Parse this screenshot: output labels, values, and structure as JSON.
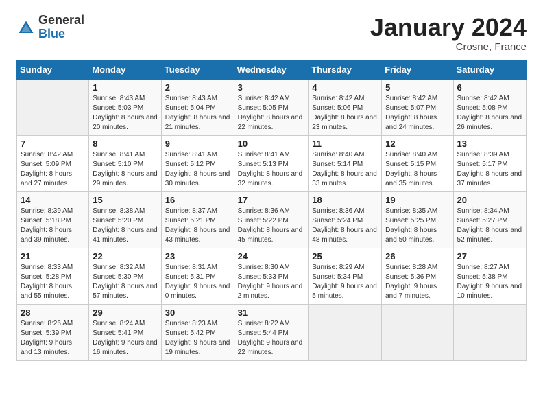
{
  "logo": {
    "general": "General",
    "blue": "Blue"
  },
  "header": {
    "title": "January 2024",
    "subtitle": "Crosne, France"
  },
  "weekdays": [
    "Sunday",
    "Monday",
    "Tuesday",
    "Wednesday",
    "Thursday",
    "Friday",
    "Saturday"
  ],
  "weeks": [
    [
      {
        "day": "",
        "empty": true
      },
      {
        "day": "1",
        "sunrise": "Sunrise: 8:43 AM",
        "sunset": "Sunset: 5:03 PM",
        "daylight": "Daylight: 8 hours and 20 minutes."
      },
      {
        "day": "2",
        "sunrise": "Sunrise: 8:43 AM",
        "sunset": "Sunset: 5:04 PM",
        "daylight": "Daylight: 8 hours and 21 minutes."
      },
      {
        "day": "3",
        "sunrise": "Sunrise: 8:42 AM",
        "sunset": "Sunset: 5:05 PM",
        "daylight": "Daylight: 8 hours and 22 minutes."
      },
      {
        "day": "4",
        "sunrise": "Sunrise: 8:42 AM",
        "sunset": "Sunset: 5:06 PM",
        "daylight": "Daylight: 8 hours and 23 minutes."
      },
      {
        "day": "5",
        "sunrise": "Sunrise: 8:42 AM",
        "sunset": "Sunset: 5:07 PM",
        "daylight": "Daylight: 8 hours and 24 minutes."
      },
      {
        "day": "6",
        "sunrise": "Sunrise: 8:42 AM",
        "sunset": "Sunset: 5:08 PM",
        "daylight": "Daylight: 8 hours and 26 minutes."
      }
    ],
    [
      {
        "day": "7",
        "sunrise": "Sunrise: 8:42 AM",
        "sunset": "Sunset: 5:09 PM",
        "daylight": "Daylight: 8 hours and 27 minutes."
      },
      {
        "day": "8",
        "sunrise": "Sunrise: 8:41 AM",
        "sunset": "Sunset: 5:10 PM",
        "daylight": "Daylight: 8 hours and 29 minutes."
      },
      {
        "day": "9",
        "sunrise": "Sunrise: 8:41 AM",
        "sunset": "Sunset: 5:12 PM",
        "daylight": "Daylight: 8 hours and 30 minutes."
      },
      {
        "day": "10",
        "sunrise": "Sunrise: 8:41 AM",
        "sunset": "Sunset: 5:13 PM",
        "daylight": "Daylight: 8 hours and 32 minutes."
      },
      {
        "day": "11",
        "sunrise": "Sunrise: 8:40 AM",
        "sunset": "Sunset: 5:14 PM",
        "daylight": "Daylight: 8 hours and 33 minutes."
      },
      {
        "day": "12",
        "sunrise": "Sunrise: 8:40 AM",
        "sunset": "Sunset: 5:15 PM",
        "daylight": "Daylight: 8 hours and 35 minutes."
      },
      {
        "day": "13",
        "sunrise": "Sunrise: 8:39 AM",
        "sunset": "Sunset: 5:17 PM",
        "daylight": "Daylight: 8 hours and 37 minutes."
      }
    ],
    [
      {
        "day": "14",
        "sunrise": "Sunrise: 8:39 AM",
        "sunset": "Sunset: 5:18 PM",
        "daylight": "Daylight: 8 hours and 39 minutes."
      },
      {
        "day": "15",
        "sunrise": "Sunrise: 8:38 AM",
        "sunset": "Sunset: 5:20 PM",
        "daylight": "Daylight: 8 hours and 41 minutes."
      },
      {
        "day": "16",
        "sunrise": "Sunrise: 8:37 AM",
        "sunset": "Sunset: 5:21 PM",
        "daylight": "Daylight: 8 hours and 43 minutes."
      },
      {
        "day": "17",
        "sunrise": "Sunrise: 8:36 AM",
        "sunset": "Sunset: 5:22 PM",
        "daylight": "Daylight: 8 hours and 45 minutes."
      },
      {
        "day": "18",
        "sunrise": "Sunrise: 8:36 AM",
        "sunset": "Sunset: 5:24 PM",
        "daylight": "Daylight: 8 hours and 48 minutes."
      },
      {
        "day": "19",
        "sunrise": "Sunrise: 8:35 AM",
        "sunset": "Sunset: 5:25 PM",
        "daylight": "Daylight: 8 hours and 50 minutes."
      },
      {
        "day": "20",
        "sunrise": "Sunrise: 8:34 AM",
        "sunset": "Sunset: 5:27 PM",
        "daylight": "Daylight: 8 hours and 52 minutes."
      }
    ],
    [
      {
        "day": "21",
        "sunrise": "Sunrise: 8:33 AM",
        "sunset": "Sunset: 5:28 PM",
        "daylight": "Daylight: 8 hours and 55 minutes."
      },
      {
        "day": "22",
        "sunrise": "Sunrise: 8:32 AM",
        "sunset": "Sunset: 5:30 PM",
        "daylight": "Daylight: 8 hours and 57 minutes."
      },
      {
        "day": "23",
        "sunrise": "Sunrise: 8:31 AM",
        "sunset": "Sunset: 5:31 PM",
        "daylight": "Daylight: 9 hours and 0 minutes."
      },
      {
        "day": "24",
        "sunrise": "Sunrise: 8:30 AM",
        "sunset": "Sunset: 5:33 PM",
        "daylight": "Daylight: 9 hours and 2 minutes."
      },
      {
        "day": "25",
        "sunrise": "Sunrise: 8:29 AM",
        "sunset": "Sunset: 5:34 PM",
        "daylight": "Daylight: 9 hours and 5 minutes."
      },
      {
        "day": "26",
        "sunrise": "Sunrise: 8:28 AM",
        "sunset": "Sunset: 5:36 PM",
        "daylight": "Daylight: 9 hours and 7 minutes."
      },
      {
        "day": "27",
        "sunrise": "Sunrise: 8:27 AM",
        "sunset": "Sunset: 5:38 PM",
        "daylight": "Daylight: 9 hours and 10 minutes."
      }
    ],
    [
      {
        "day": "28",
        "sunrise": "Sunrise: 8:26 AM",
        "sunset": "Sunset: 5:39 PM",
        "daylight": "Daylight: 9 hours and 13 minutes."
      },
      {
        "day": "29",
        "sunrise": "Sunrise: 8:24 AM",
        "sunset": "Sunset: 5:41 PM",
        "daylight": "Daylight: 9 hours and 16 minutes."
      },
      {
        "day": "30",
        "sunrise": "Sunrise: 8:23 AM",
        "sunset": "Sunset: 5:42 PM",
        "daylight": "Daylight: 9 hours and 19 minutes."
      },
      {
        "day": "31",
        "sunrise": "Sunrise: 8:22 AM",
        "sunset": "Sunset: 5:44 PM",
        "daylight": "Daylight: 9 hours and 22 minutes."
      },
      {
        "day": "",
        "empty": true
      },
      {
        "day": "",
        "empty": true
      },
      {
        "day": "",
        "empty": true
      }
    ]
  ]
}
